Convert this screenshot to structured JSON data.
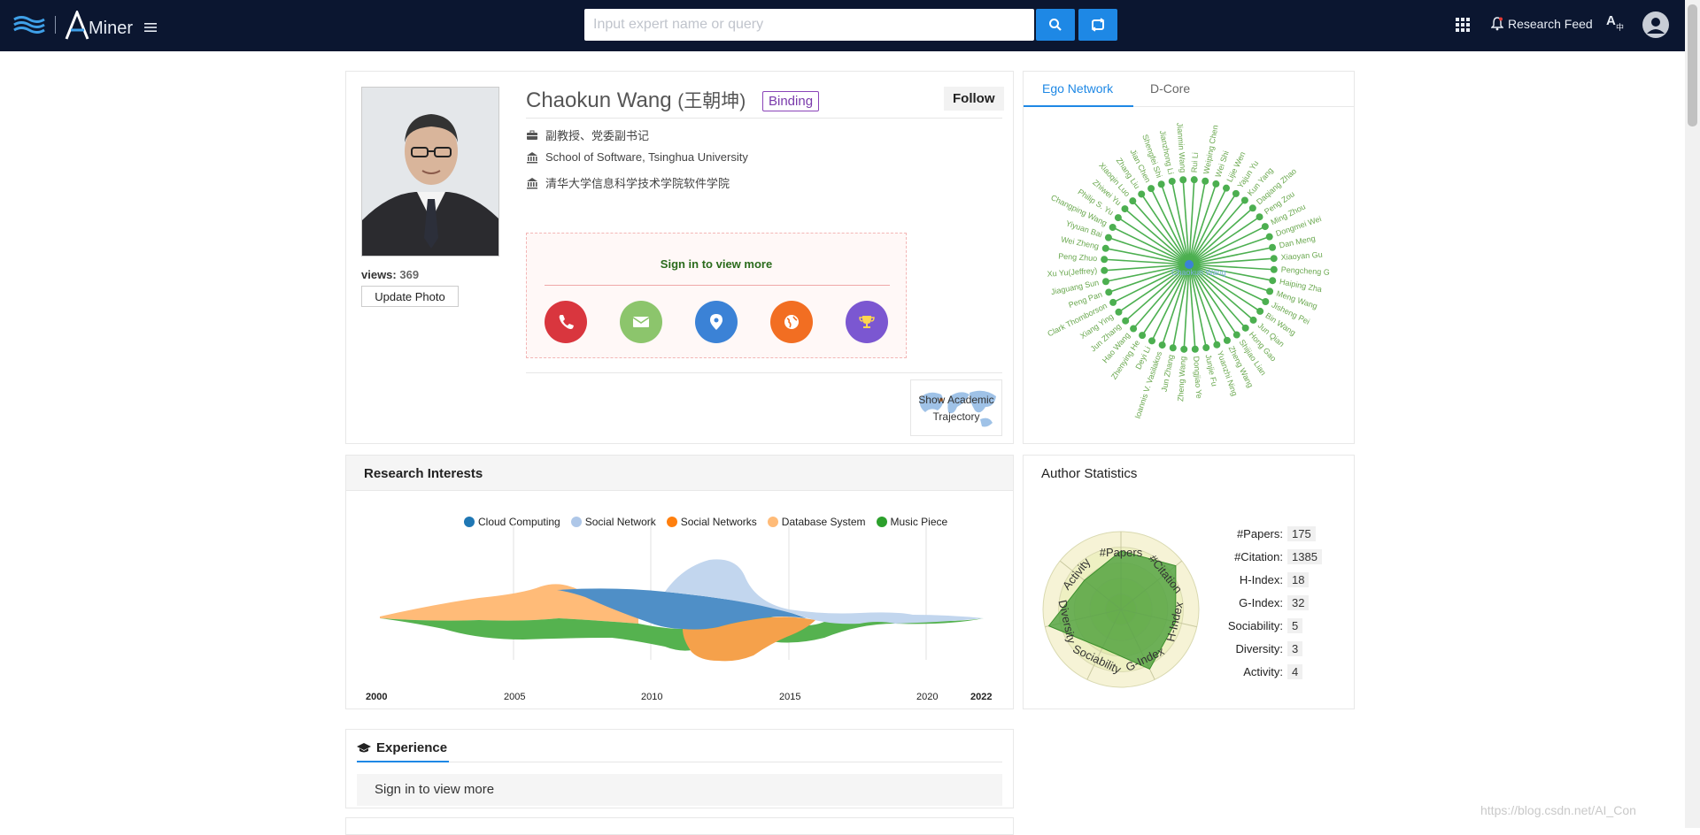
{
  "topbar": {
    "brand": "Miner",
    "search_placeholder": "Input expert name or query",
    "research_feed": "Research Feed"
  },
  "profile": {
    "name": "Chaokun Wang",
    "name_cn": "(王朝坤)",
    "binding": "Binding",
    "follow": "Follow",
    "title": "副教授、党委副书记",
    "affiliation_en": "School of Software, Tsinghua University",
    "affiliation_cn": "清华大学信息科学技术学院软件学院",
    "views_label": "views:",
    "views_value": "369",
    "update_photo": "Update Photo",
    "signin_text": "Sign in to view more",
    "trajectory_line1": "Show Academic",
    "trajectory_line2": "Trajectory",
    "contact_icons": [
      "phone-icon",
      "email-icon",
      "location-icon",
      "globe-icon",
      "trophy-icon"
    ],
    "contact_colors": [
      "#d9363e",
      "#8cc56c",
      "#3b82d6",
      "#f26e22",
      "#7b57d1"
    ]
  },
  "ego": {
    "tab_active": "Ego Network",
    "tab_other": "D-Core",
    "center": "Chaokun Wang",
    "nodes": [
      "Rui Li",
      "Weiping Chen",
      "Wei Shi",
      "Lijie Wen",
      "Yajun Yu",
      "Kun Yang",
      "Daqiang Zhao",
      "Peng Zou",
      "Ming Zhou",
      "Dongmei Wei",
      "Dan Meng",
      "Xiaoyan Gu",
      "Pengcheng G",
      "Haiping Zha",
      "Meng Wang",
      "Jisheng Pei",
      "Bin Wang",
      "Jun Qian",
      "Hong Gao",
      "Shijiao Lian",
      "Zheng Wang",
      "Yuanzhi Ning",
      "Junjie Fu",
      "Dongjiao Ye",
      "Zheng Wang",
      "Jun Zhang",
      "Ioannis V. Vasilakos",
      "Deyi Li",
      "Zhenying He",
      "Hao Wang",
      "Jun Zhang",
      "Xiang Ying",
      "Clark Thomborson",
      "Peng Pan",
      "Jiaguang Sun",
      "Xu Yu(Jeffrey)",
      "Peng Zhuo",
      "Wei Zheng",
      "Yiyuan Bai",
      "Changping Wang",
      "Philip S. Yu",
      "Zhiwei Yu",
      "Xiaoqin Luo",
      "Zhang Liu",
      "Jian Chen",
      "Shengfei Shi",
      "Jianzhong Li",
      "Jianmin Wang"
    ]
  },
  "interests": {
    "title": "Research Interests",
    "legend": [
      {
        "name": "Cloud Computing",
        "color": "#1f77b4"
      },
      {
        "name": "Social Network",
        "color": "#aec7e8"
      },
      {
        "name": "Social Networks",
        "color": "#ff7f0e"
      },
      {
        "name": "Database System",
        "color": "#ffbb78"
      },
      {
        "name": "Music Piece",
        "color": "#2ca02c"
      }
    ],
    "years": [
      "2000",
      "2005",
      "2010",
      "2015",
      "2020",
      "2022"
    ]
  },
  "stats": {
    "title": "Author Statistics",
    "rows": [
      {
        "label": "#Papers:",
        "value": "175"
      },
      {
        "label": "#Citation:",
        "value": "1385"
      },
      {
        "label": "H-Index:",
        "value": "18"
      },
      {
        "label": "G-Index:",
        "value": "32"
      },
      {
        "label": "Sociability:",
        "value": "5"
      },
      {
        "label": "Diversity:",
        "value": "3"
      },
      {
        "label": "Activity:",
        "value": "4"
      }
    ],
    "radar_axes": [
      "#Papers",
      "#Citation",
      "H-Index",
      "G-Index",
      "Sociability",
      "Diversity",
      "Activity"
    ],
    "radar_values": [
      0.75,
      0.9,
      0.72,
      0.85,
      0.55,
      0.95,
      0.6
    ]
  },
  "experience": {
    "title": "Experience",
    "signin": "Sign in to view more"
  },
  "watermark": "https://blog.csdn.net/AI_Con"
}
